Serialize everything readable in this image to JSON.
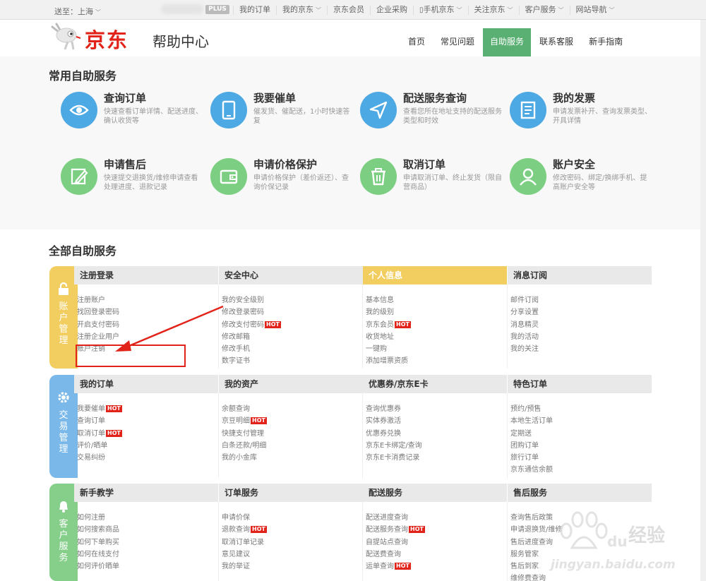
{
  "topbar": {
    "location": "送至：上海",
    "plus": "PLUS",
    "items": [
      "我的订单",
      "我的京东",
      "京东会员",
      "企业采购",
      "手机京东",
      "关注京东",
      "客户服务",
      "网站导航"
    ]
  },
  "header": {
    "logo_text": "京东",
    "title": "帮助中心",
    "nav": [
      "首页",
      "常见问题",
      "自助服务",
      "联系客服",
      "新手指南"
    ],
    "active_nav": "自助服务"
  },
  "common": {
    "title": "常用自助服务",
    "services": [
      {
        "title": "查询订单",
        "desc": "快速查看订单详情、配送进度、确认收货等",
        "icon": "eye-icon",
        "color": "#4da9e4"
      },
      {
        "title": "我要催单",
        "desc": "催发货、催配送，1小时快速答复",
        "icon": "phone-icon",
        "color": "#4da9e4"
      },
      {
        "title": "配送服务查询",
        "desc": "查看您所在地址支持的配送服务类型和时效",
        "icon": "paper-plane-icon",
        "color": "#4da9e4"
      },
      {
        "title": "我的发票",
        "desc": "申请发票补开、查询发票类型、开具详情",
        "icon": "invoice-icon",
        "color": "#4da9e4"
      },
      {
        "title": "申请售后",
        "desc": "快速提交退换货/维修申请查看处理进度、退款记录",
        "icon": "pencil-icon",
        "color": "#7ccf82"
      },
      {
        "title": "申请价格保护",
        "desc": "申请价格保护（差价返还）、查询价保记录",
        "icon": "wallet-icon",
        "color": "#7ccf82"
      },
      {
        "title": "取消订单",
        "desc": "申请取消订单、终止发货（限自营商品）",
        "icon": "trash-icon",
        "color": "#7ccf82"
      },
      {
        "title": "账户安全",
        "desc": "修改密码、绑定/换绑手机、提高账户安全等",
        "icon": "user-icon",
        "color": "#7ccf82"
      }
    ]
  },
  "all": {
    "title": "全部自助服务",
    "groups": [
      {
        "label": "账户管理",
        "icon": "lock-icon",
        "color": "#f2ce61",
        "columns": [
          {
            "header": "注册登录",
            "items": [
              {
                "t": "注册账户"
              },
              {
                "t": "找回登录密码"
              },
              {
                "t": "开启支付密码"
              },
              {
                "t": "注册企业用户"
              },
              {
                "t": "账户注销"
              }
            ]
          },
          {
            "header": "安全中心",
            "items": [
              {
                "t": "我的安全级别"
              },
              {
                "t": "修改登录密码"
              },
              {
                "t": "修改支付密码",
                "hot": "HOT"
              },
              {
                "t": "修改邮箱"
              },
              {
                "t": "修改手机"
              },
              {
                "t": "数字证书"
              }
            ]
          },
          {
            "header": "个人信息",
            "highlight": true,
            "items": [
              {
                "t": "基本信息"
              },
              {
                "t": "我的级别"
              },
              {
                "t": "京东会员",
                "hot": "HOT"
              },
              {
                "t": "收货地址"
              },
              {
                "t": "一键购"
              },
              {
                "t": "添加增票资质"
              }
            ]
          },
          {
            "header": "消息订阅",
            "items": [
              {
                "t": "邮件订阅"
              },
              {
                "t": "分享设置"
              },
              {
                "t": "消息精灵"
              },
              {
                "t": "我的活动"
              },
              {
                "t": "我的关注"
              }
            ]
          }
        ]
      },
      {
        "label": "交易管理",
        "icon": "gear-icon",
        "color": "#7ab8ea",
        "columns": [
          {
            "header": "我的订单",
            "items": [
              {
                "t": "我要催单",
                "hot": "HOT"
              },
              {
                "t": "查询订单"
              },
              {
                "t": "取消订单",
                "hot": "HOT"
              },
              {
                "t": "评价/晒单"
              },
              {
                "t": "交易纠纷"
              }
            ]
          },
          {
            "header": "我的资产",
            "items": [
              {
                "t": "余额查询"
              },
              {
                "t": "京豆明细",
                "hot": "HOT"
              },
              {
                "t": "快捷支付管理"
              },
              {
                "t": "白条还款/明细"
              },
              {
                "t": "我的小金库"
              }
            ]
          },
          {
            "header": "优惠券/京东E卡",
            "items": [
              {
                "t": "查询优惠券"
              },
              {
                "t": "实体券激活"
              },
              {
                "t": "优惠券兑换"
              },
              {
                "t": "京东E卡绑定/查询"
              },
              {
                "t": "京东E卡消费记录"
              }
            ]
          },
          {
            "header": "特色订单",
            "items": [
              {
                "t": "预约/预售"
              },
              {
                "t": "本地生活订单"
              },
              {
                "t": "定期送"
              },
              {
                "t": "团购订单"
              },
              {
                "t": "旅行订单"
              },
              {
                "t": "京东通信余额"
              }
            ]
          }
        ]
      },
      {
        "label": "客户服务",
        "icon": "bell-icon",
        "color": "#86cf8b",
        "columns": [
          {
            "header": "新手教学",
            "items": [
              {
                "t": "如何注册"
              },
              {
                "t": "如何搜索商品"
              },
              {
                "t": "如何下单购买"
              },
              {
                "t": "如何在线支付"
              },
              {
                "t": "如何评价晒单"
              }
            ]
          },
          {
            "header": "订单服务",
            "items": [
              {
                "t": "申请价保"
              },
              {
                "t": "退款查询",
                "hot": "HOT"
              },
              {
                "t": "取消订单记录"
              },
              {
                "t": "意见建议"
              },
              {
                "t": "我的举证"
              }
            ]
          },
          {
            "header": "配送服务",
            "items": [
              {
                "t": "配送进度查询"
              },
              {
                "t": "配送服务查询",
                "hot": "HOT"
              },
              {
                "t": "自提站点查询"
              },
              {
                "t": "配送费查询"
              },
              {
                "t": "运单查询",
                "hot": "HOT"
              }
            ]
          },
          {
            "header": "售后服务",
            "items": [
              {
                "t": "查询售后政策"
              },
              {
                "t": "申请退换货/维修"
              },
              {
                "t": "售后进度查询"
              },
              {
                "t": "服务管家"
              },
              {
                "t": "售后到家"
              },
              {
                "t": "维修费查询"
              }
            ]
          }
        ]
      }
    ]
  },
  "watermark": {
    "brand": "经验",
    "url": "jingyan.baidu.com"
  }
}
